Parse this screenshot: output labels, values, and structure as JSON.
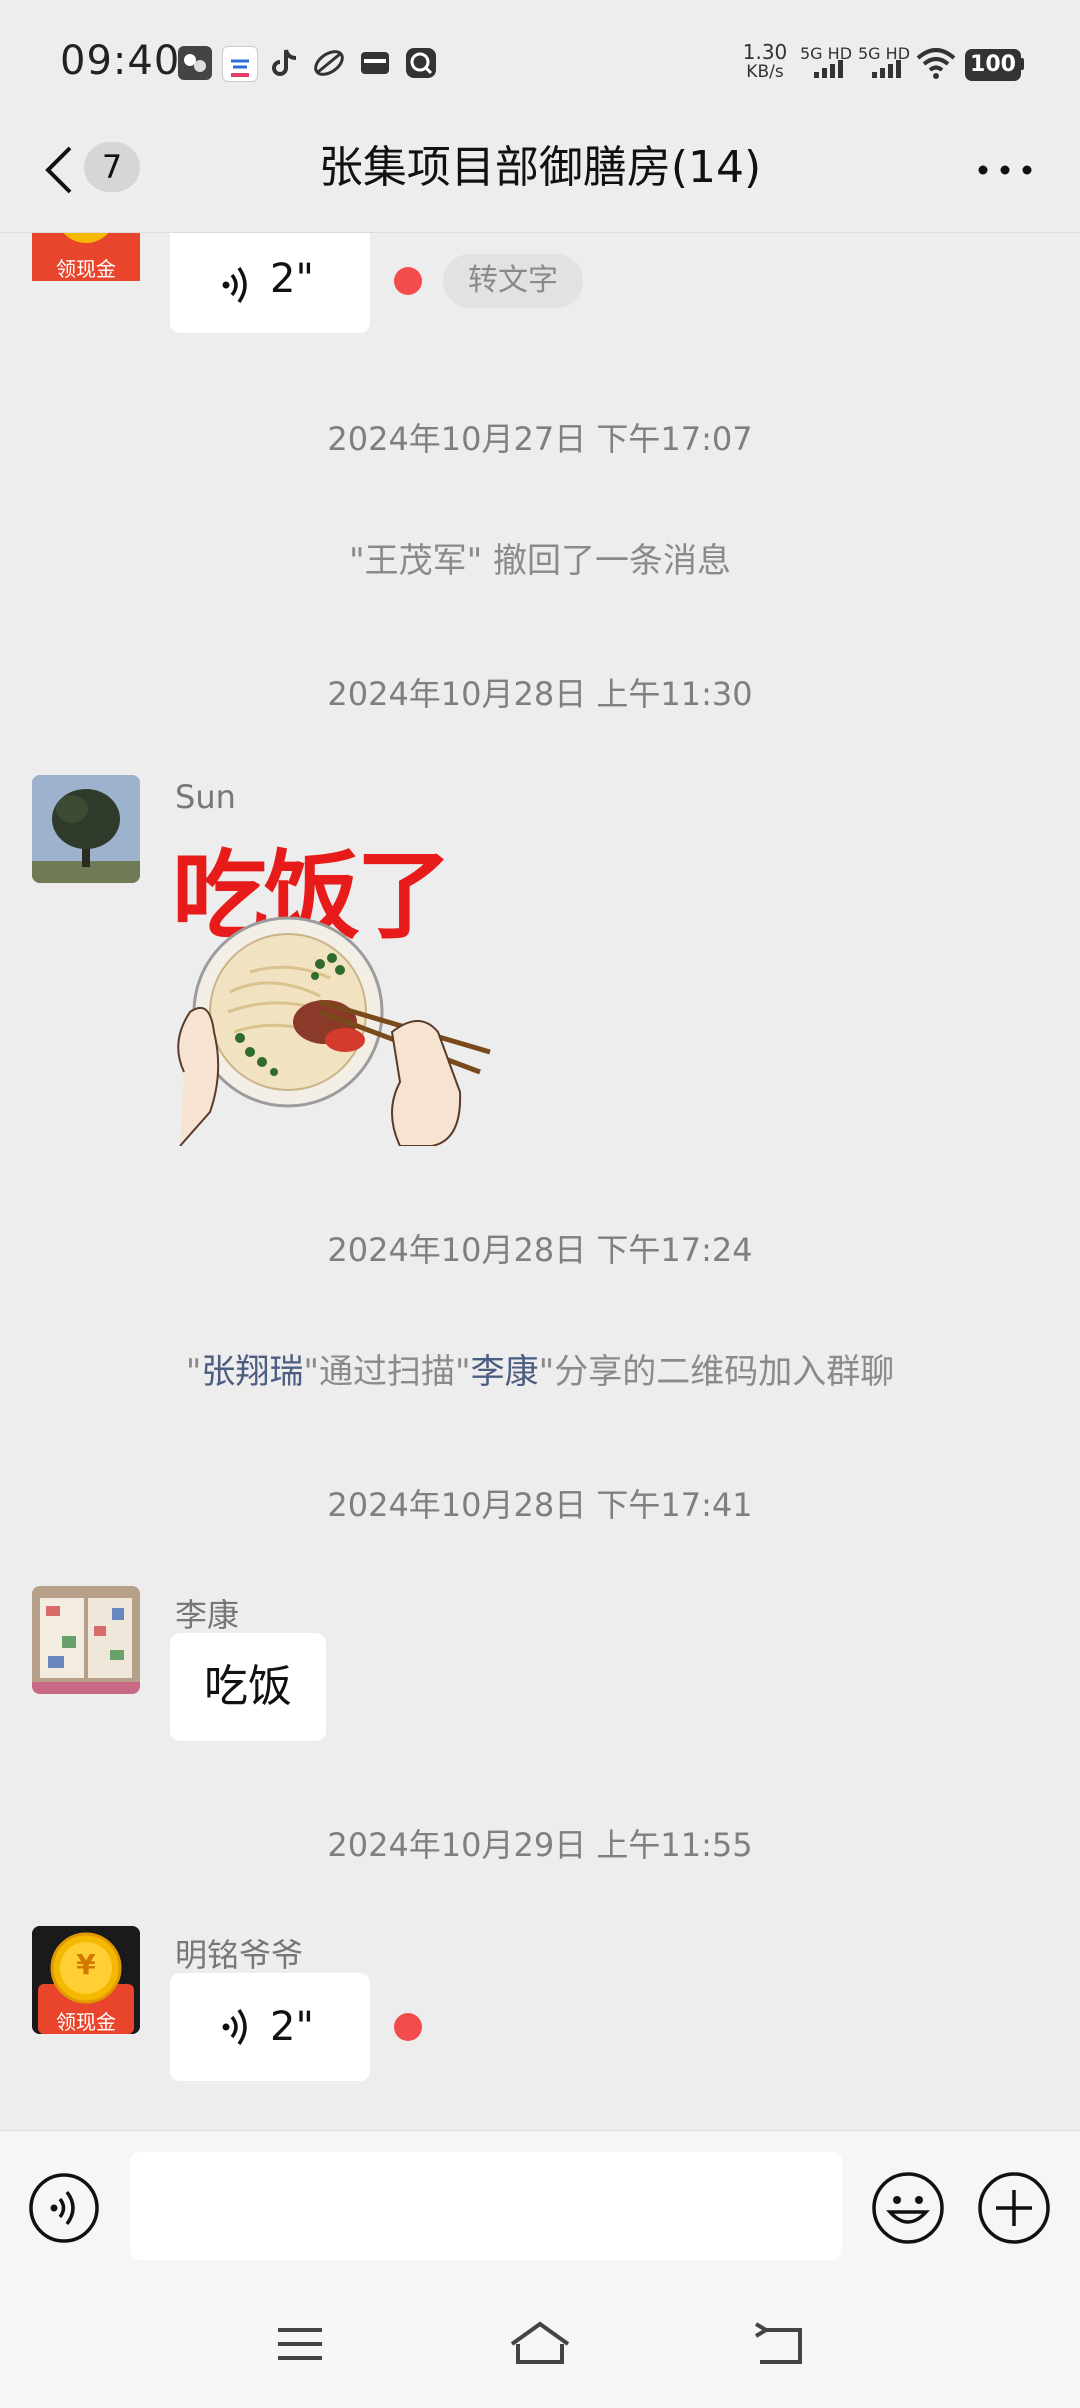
{
  "status_bar": {
    "time": "09:40",
    "net_speed_value": "1.30",
    "net_speed_unit": "KB/s",
    "sim1": "5G HD",
    "sim2": "5G HD",
    "battery": "100",
    "icons": [
      "gallery-app-icon",
      "cloud-app-icon",
      "tiktok-icon",
      "leaf-app-icon",
      "wallet-app-icon",
      "search-app-icon"
    ]
  },
  "header": {
    "back_badge": "7",
    "title": "张集项目部御膳房(14)"
  },
  "messages": {
    "top_voice": {
      "duration": "2\"",
      "to_text": "转文字",
      "avatar_label": "领现金"
    },
    "ts1": "2024年10月27日 下午17:07",
    "recall_notice": "\"王茂军\" 撤回了一条消息",
    "ts2": "2024年10月28日 上午11:30",
    "sun": {
      "sender": "Sun",
      "sticker_text": "吃饭了"
    },
    "ts3": "2024年10月28日 下午17:24",
    "join_notice": {
      "q1": "\"",
      "name1": "张翔瑞",
      "mid": "\"通过扫描\"",
      "name2": "李康",
      "end": "\"分享的二维码加入群聊"
    },
    "ts4": "2024年10月28日 下午17:41",
    "likang": {
      "sender": "李康",
      "text": "吃饭"
    },
    "ts5": "2024年10月29日 上午11:55",
    "mingming": {
      "sender": "明铭爷爷",
      "duration": "2\"",
      "avatar_label": "领现金",
      "coin_symbol": "¥"
    }
  },
  "input": {
    "placeholder": ""
  },
  "colors": {
    "background": "#ededed",
    "bubble": "#ffffff",
    "unread_dot": "#f24c4c",
    "mention": "#4c5d82",
    "red_packet": "#e8452c",
    "coin": "#f5b800"
  }
}
